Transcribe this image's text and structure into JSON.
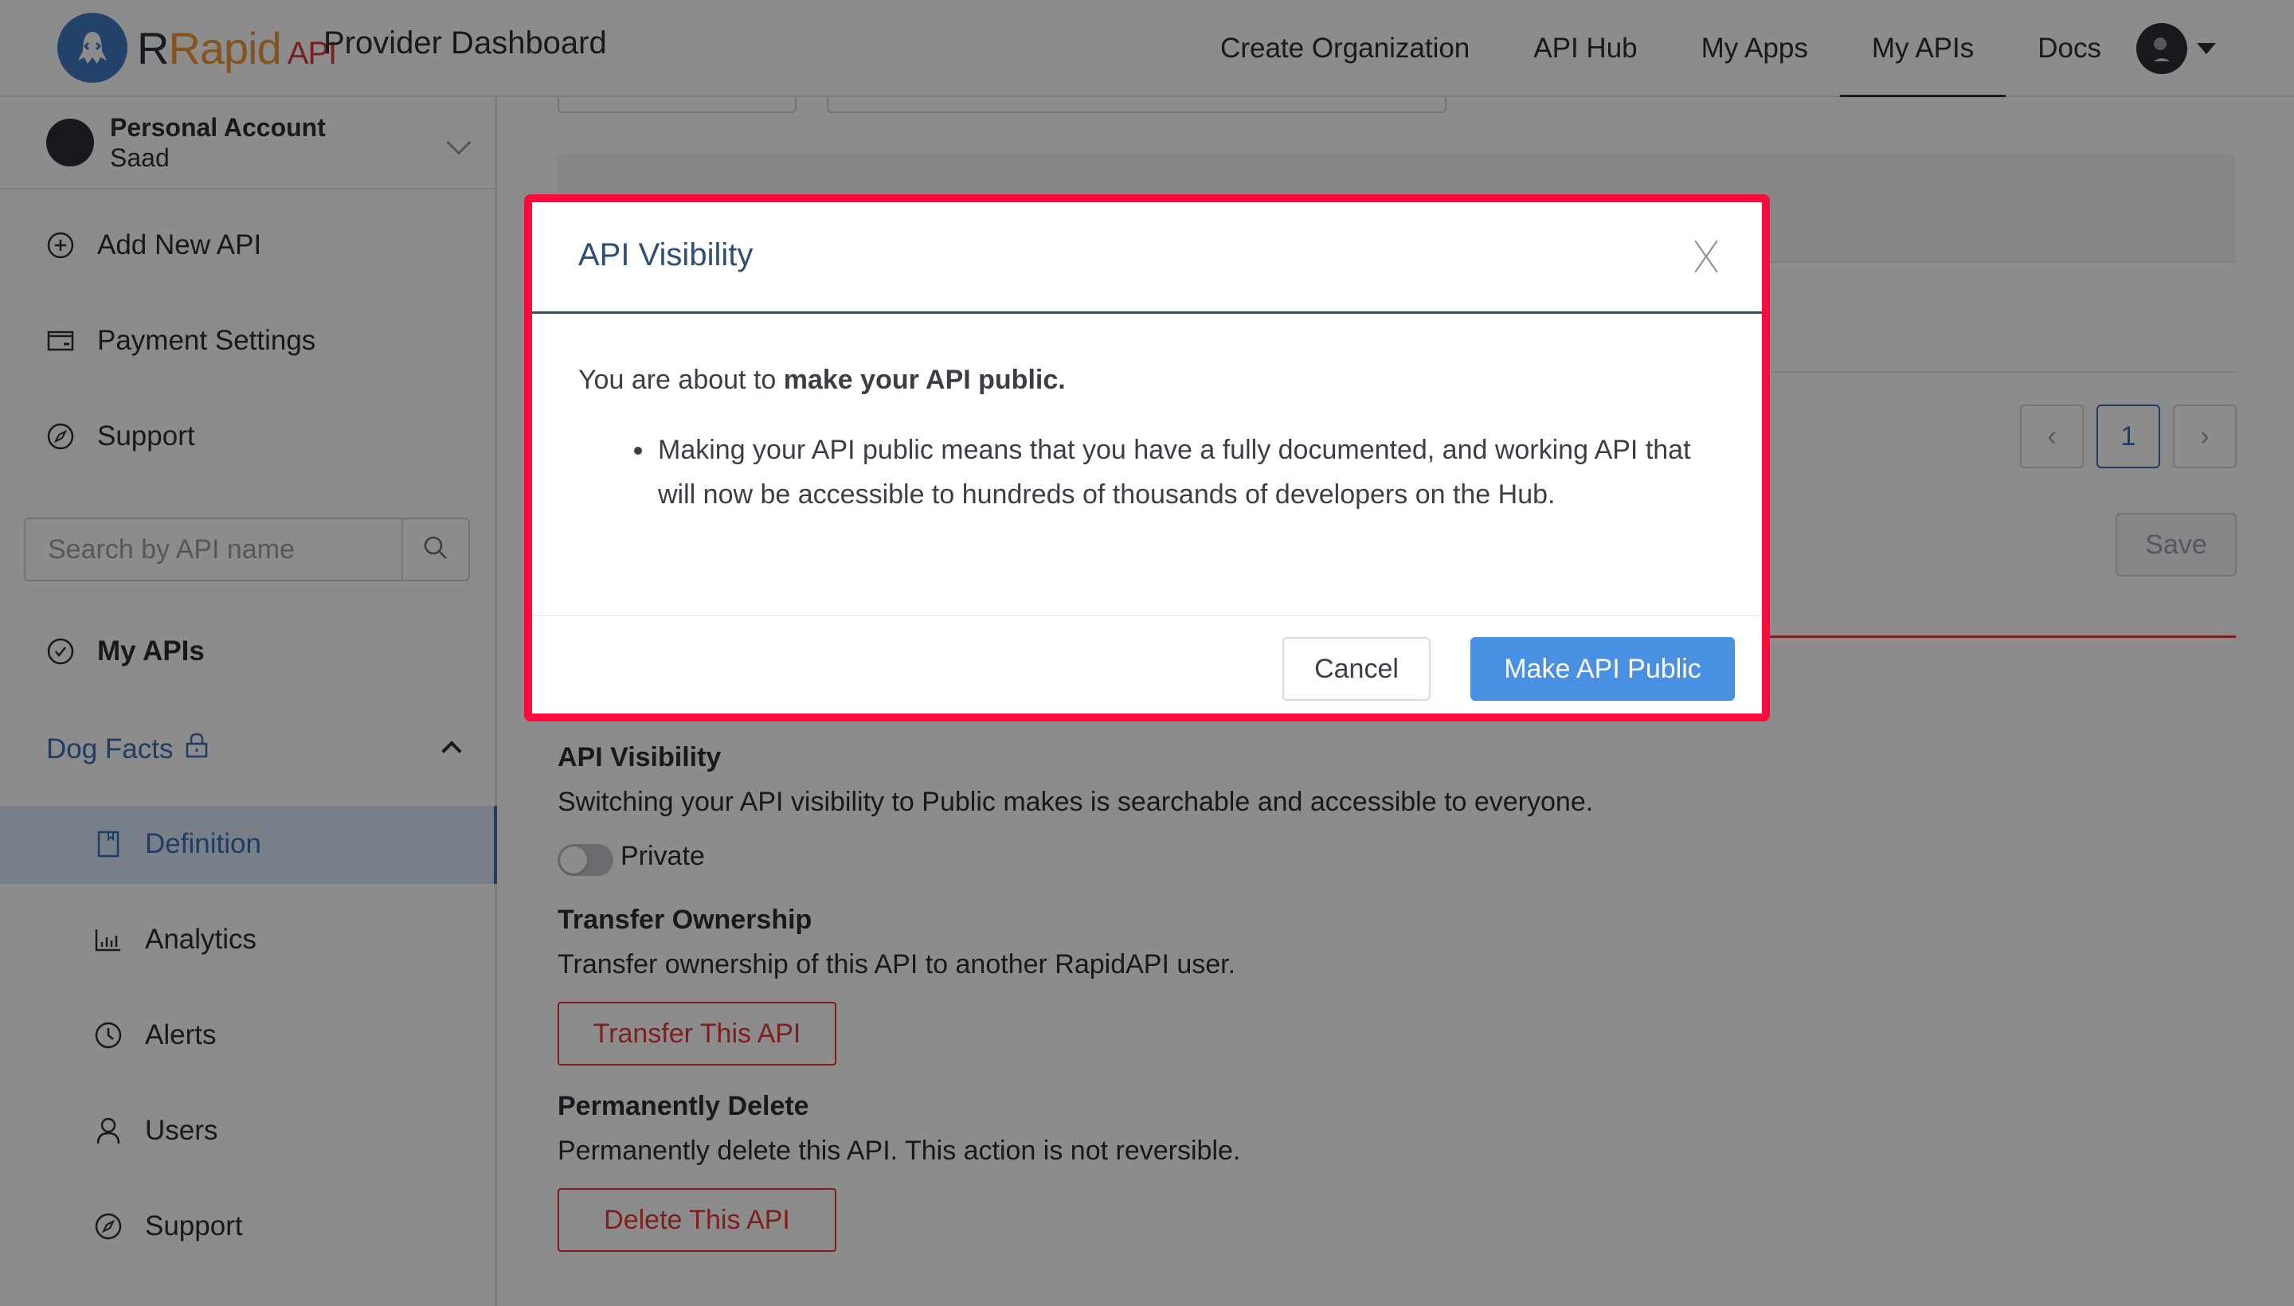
{
  "header": {
    "logo": {
      "brand_rapid": "Rapid",
      "brand_api": "API",
      "icon": "rapidapi-octopus-logo"
    },
    "app_title": "Provider Dashboard",
    "nav": [
      {
        "label": "Create Organization",
        "active": false
      },
      {
        "label": "API Hub",
        "active": false
      },
      {
        "label": "My Apps",
        "active": false
      },
      {
        "label": "My APIs",
        "active": true
      },
      {
        "label": "Docs",
        "active": false
      }
    ],
    "user_menu": {
      "avatar": "user-avatar",
      "caret": "caret-down-icon"
    }
  },
  "sidebar": {
    "account": {
      "title": "Personal Account",
      "name": "Saad"
    },
    "items": [
      {
        "label": "Add New API",
        "icon": "plus-circle-icon"
      },
      {
        "label": "Payment Settings",
        "icon": "credit-card-icon"
      },
      {
        "label": "Support",
        "icon": "compass-icon"
      }
    ],
    "search": {
      "placeholder": "Search by API name",
      "value": ""
    },
    "my_apis_label": "My APIs",
    "api": {
      "name": "Dog Facts",
      "locked": true,
      "subitems": [
        {
          "label": "Definition",
          "icon": "bookmark-doc-icon",
          "active": true
        },
        {
          "label": "Analytics",
          "icon": "bar-chart-icon",
          "active": false
        },
        {
          "label": "Alerts",
          "icon": "clock-icon",
          "active": false
        },
        {
          "label": "Users",
          "icon": "user-icon",
          "active": false
        },
        {
          "label": "Support",
          "icon": "compass-icon",
          "active": false
        }
      ]
    }
  },
  "main": {
    "pagination": {
      "prev": "‹",
      "current": "1",
      "next": "›"
    },
    "save_label": "Save",
    "visibility": {
      "title": "API Visibility",
      "description": "Switching your API visibility to Public makes is searchable and accessible to everyone.",
      "toggle_label": "Private",
      "is_public": false
    },
    "transfer": {
      "title": "Transfer Ownership",
      "description": "Transfer ownership of this API to another RapidAPI user.",
      "button": "Transfer This API"
    },
    "delete": {
      "title": "Permanently Delete",
      "description": "Permanently delete this API. This action is not reversible.",
      "button": "Delete This API"
    }
  },
  "modal": {
    "title": "API Visibility",
    "lead_prefix": "You are about to ",
    "lead_bold": "make your API public.",
    "bullets": [
      "Making your API public means that you have a fully documented, and working API that will now be accessible to hundreds of thousands of developers on the Hub."
    ],
    "cancel_label": "Cancel",
    "confirm_label": "Make API Public"
  },
  "colors": {
    "primary": "#4a90e2",
    "brand_blue": "#3a6fb5",
    "danger": "#e53935",
    "highlight": "#ff0a3a",
    "title_navy": "#2e4e78"
  }
}
